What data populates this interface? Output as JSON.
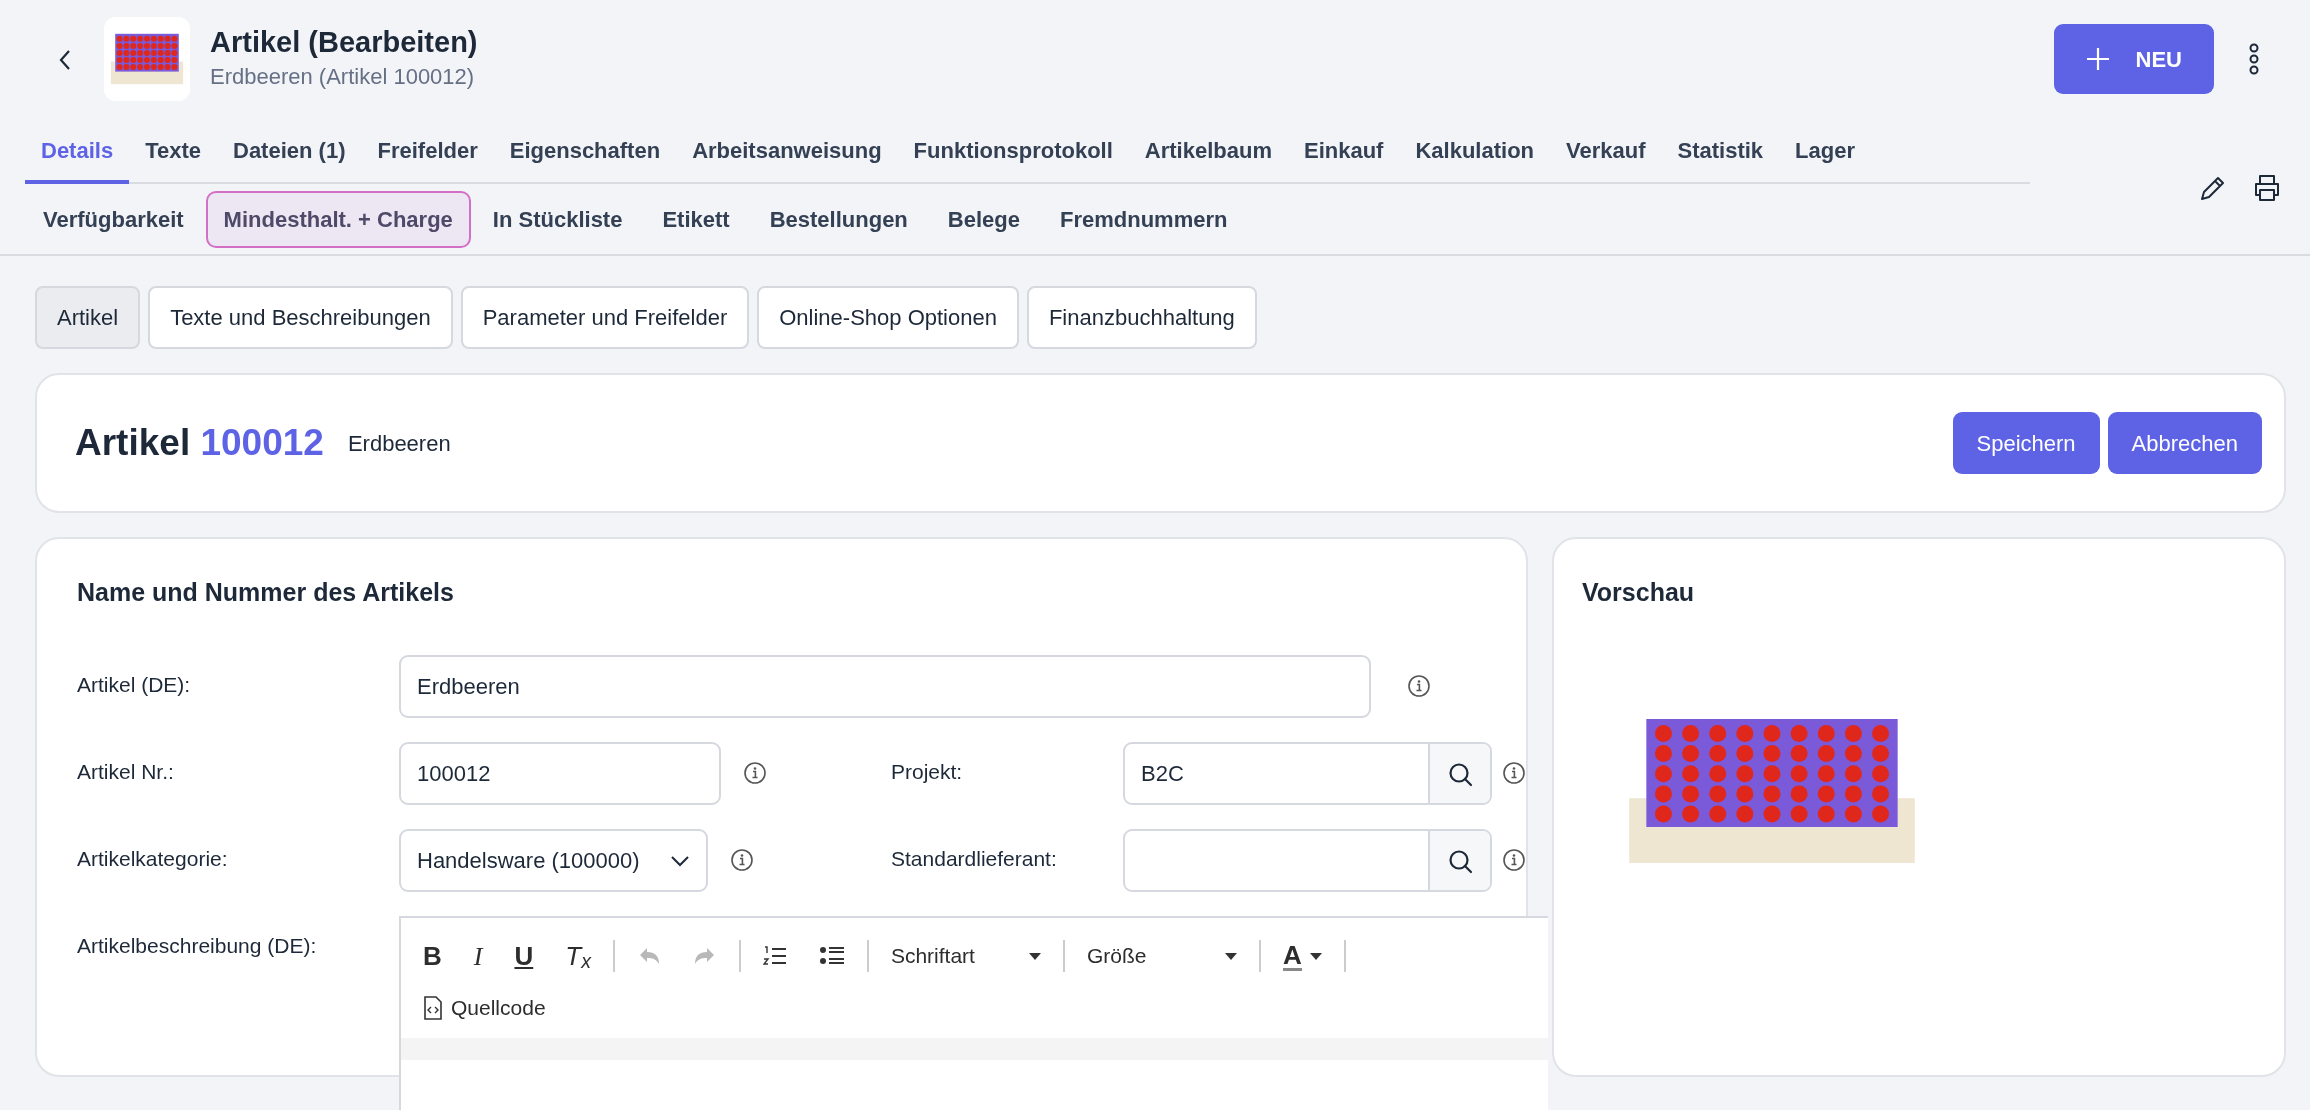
{
  "header": {
    "title": "Artikel (Bearbeiten)",
    "subtitle": "Erdbeeren (Artikel 100012)",
    "new_button": "NEU"
  },
  "tabs": [
    {
      "label": "Details",
      "selected": true
    },
    {
      "label": "Texte",
      "selected": false
    },
    {
      "label": "Dateien (1)",
      "selected": false
    },
    {
      "label": "Freifelder",
      "selected": false
    },
    {
      "label": "Eigenschaften",
      "selected": false
    },
    {
      "label": "Arbeitsanweisung",
      "selected": false
    },
    {
      "label": "Funktionsprotokoll",
      "selected": false
    },
    {
      "label": "Artikelbaum",
      "selected": false
    },
    {
      "label": "Einkauf",
      "selected": false
    },
    {
      "label": "Kalkulation",
      "selected": false
    },
    {
      "label": "Verkauf",
      "selected": false
    },
    {
      "label": "Statistik",
      "selected": false
    },
    {
      "label": "Lager",
      "selected": false
    }
  ],
  "subtabs": [
    {
      "label": "Verfügbarkeit",
      "focused": false
    },
    {
      "label": "Mindesthalt. + Charge",
      "focused": true
    },
    {
      "label": "In Stückliste",
      "focused": false
    },
    {
      "label": "Etikett",
      "focused": false
    },
    {
      "label": "Bestellungen",
      "focused": false
    },
    {
      "label": "Belege",
      "focused": false
    },
    {
      "label": "Fremdnummern",
      "focused": false
    }
  ],
  "section_buttons": [
    {
      "label": "Artikel",
      "selected": true
    },
    {
      "label": "Texte und Beschreibungen",
      "selected": false
    },
    {
      "label": "Parameter und Freifelder",
      "selected": false
    },
    {
      "label": "Online-Shop Optionen",
      "selected": false
    },
    {
      "label": "Finanzbuchhaltung",
      "selected": false
    }
  ],
  "article_card": {
    "label": "Artikel",
    "number": "100012",
    "name": "Erdbeeren",
    "buttons": [
      "Speichern",
      "Abbrechen"
    ]
  },
  "form": {
    "title": "Name und Nummer des Artikels",
    "rows": [
      [
        {
          "label": "Artikel (DE):",
          "value": "Erdbeeren",
          "kind": "text"
        }
      ],
      [
        {
          "label": "Artikel Nr.:",
          "value": "100012",
          "kind": "text"
        },
        {
          "label": "Projekt:",
          "value": "B2C",
          "kind": "lookup"
        }
      ],
      [
        {
          "label": "Artikelkategorie:",
          "value": "Handelsware (100000)",
          "kind": "select"
        },
        {
          "label": "Standardlieferant:",
          "kind": "lookup"
        }
      ]
    ],
    "editor": {
      "label": "Artikelbeschreibung (DE):",
      "tools": [
        {
          "kind": "bold",
          "label": "B"
        },
        {
          "kind": "italic",
          "label": "I"
        },
        {
          "kind": "underline",
          "label": "U"
        },
        {
          "kind": "clear",
          "label": "T$_{x}$"
        },
        {
          "kind": "separator"
        },
        {
          "kind": "undo",
          "disabled": true
        },
        {
          "kind": "redo",
          "disabled": true
        },
        {
          "kind": "separator"
        },
        {
          "kind": "ordered-list"
        },
        {
          "kind": "bullet-list"
        },
        {
          "kind": "separator"
        },
        {
          "kind": "dropdown",
          "label": "Schriftart"
        },
        {
          "kind": "separator"
        },
        {
          "kind": "dropdown",
          "label": "Größe"
        },
        {
          "kind": "separator"
        },
        {
          "kind": "color",
          "label": "A"
        },
        {
          "kind": "separator"
        }
      ],
      "source_button": "Quellcode"
    }
  },
  "preview": {
    "title": "Vorschau"
  }
}
